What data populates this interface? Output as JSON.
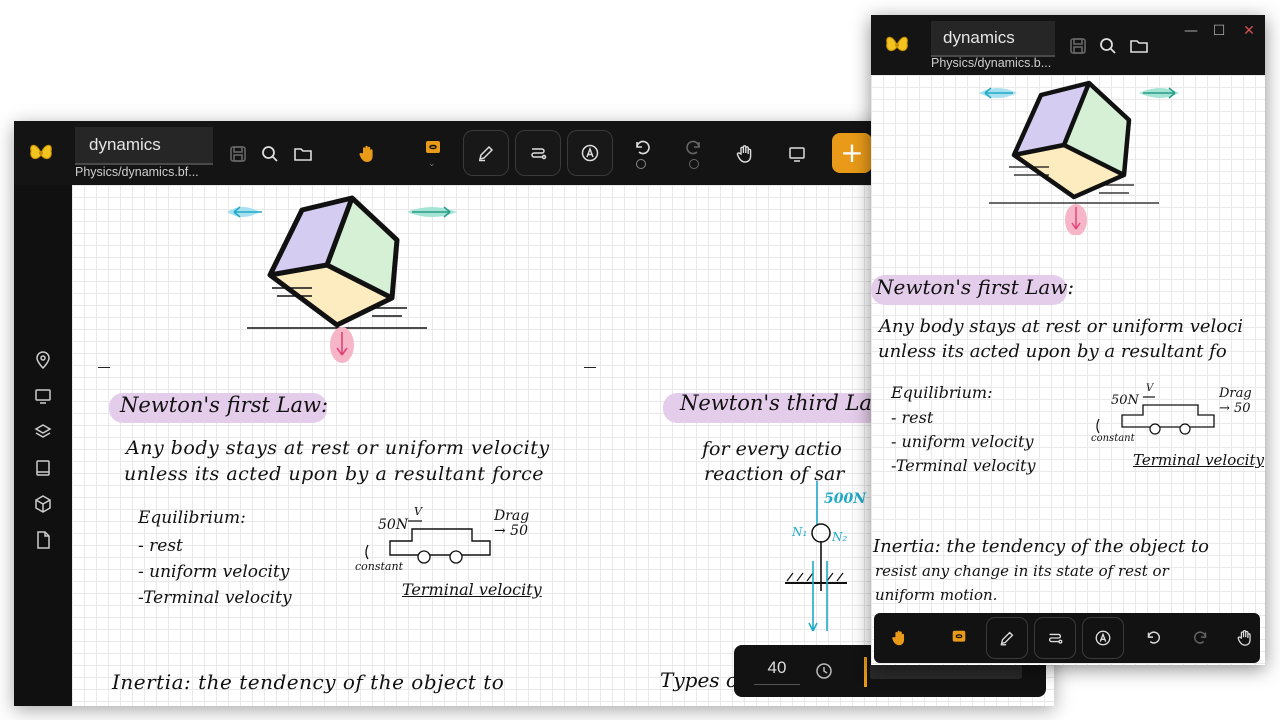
{
  "main_window": {
    "doc_title": "dynamics",
    "doc_path": "Physics/dynamics.bf...",
    "zoom": "40"
  },
  "small_window": {
    "doc_title": "dynamics",
    "doc_path": "Physics/dynamics.b...",
    "controls": {
      "minimize": "—",
      "maximize": "☐",
      "close": "✕"
    }
  },
  "notes": {
    "first_law_heading": "Newton's first Law:",
    "first_law_line1": "Any body stays at rest or uniform velocity",
    "first_law_line2": "unless its acted upon by a resultant force",
    "first_law_line1_small": "Any body stays at rest or uniform veloci",
    "first_law_line2_small": "unless its acted upon by a resultant fo",
    "equilibrium": "Equilibrium:",
    "eq_item1": "- rest",
    "eq_item2": "- uniform velocity",
    "eq_item3": "-Terminal velocity",
    "force_50n": "50N",
    "v_label": "V",
    "drag_label": "Drag",
    "drag_value": "→ 50",
    "constant": "constant",
    "terminal_velocity": "Terminal velocity",
    "third_law_heading": "Newton's third La",
    "third_law_line1": "for every actio",
    "third_law_line2": "reaction of sar",
    "force_500n": "500N",
    "n1": "N₁",
    "n2": "N₂",
    "inertia_main": "Inertia: the tendency of the object to",
    "inertia_small1": "Inertia: the tendency of the object to",
    "inertia_small2": "resist any change in its state of rest or",
    "inertia_small3": "uniform motion.",
    "types": "Types o"
  },
  "colors": {
    "accent": "#e89a18",
    "highlight_purple": "#e4cdea",
    "arrow_blue": "#1fa9c9",
    "arrow_teal": "#2a9d8a",
    "arrow_pink": "#e0457a"
  },
  "icons": {
    "app": "butterfly-logo-icon",
    "save": "save-icon",
    "search": "search-icon",
    "folder": "folder-icon",
    "hand": "hand-icon",
    "lasso": "lasso-icon",
    "pen": "pen-icon",
    "shape": "shape-icon",
    "text": "text-icon",
    "undo": "undo-icon",
    "redo": "redo-icon",
    "present": "monitor-icon",
    "add": "plus-icon",
    "history": "history-icon"
  }
}
